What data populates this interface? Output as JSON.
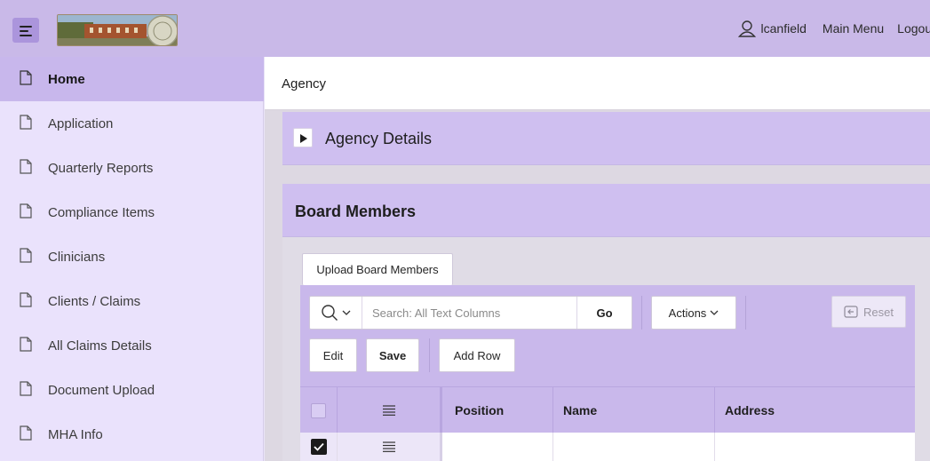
{
  "header": {
    "username": "lcanfield",
    "main_menu": "Main Menu",
    "logout": "Logout",
    "icons": {
      "menu": "hamburger-icon",
      "user": "user-icon"
    }
  },
  "sidebar": {
    "items": [
      {
        "label": "Home",
        "active": true
      },
      {
        "label": "Application"
      },
      {
        "label": "Quarterly Reports"
      },
      {
        "label": "Compliance Items"
      },
      {
        "label": "Clinicians"
      },
      {
        "label": "Clients / Claims"
      },
      {
        "label": "All Claims Details"
      },
      {
        "label": "Document Upload"
      },
      {
        "label": "MHA Info"
      }
    ],
    "item_icon": "document-icon"
  },
  "page": {
    "title": "Agency",
    "regions": {
      "agency_details": {
        "title": "Agency Details",
        "collapsed": true
      },
      "board_members": {
        "title": "Board Members"
      }
    }
  },
  "board_members": {
    "upload_button": "Upload Board Members",
    "search": {
      "placeholder": "Search: All Text Columns",
      "value": ""
    },
    "go": "Go",
    "actions": "Actions",
    "reset": "Reset",
    "edit": "Edit",
    "save": "Save",
    "add_row": "Add Row",
    "columns": [
      "Position",
      "Name",
      "Address"
    ],
    "rows": [
      {
        "selected": true,
        "position": "",
        "name": "",
        "address": ""
      }
    ]
  },
  "colors": {
    "header_bg": "#c9b9e8",
    "sidebar_bg": "#eae2fc",
    "sidebar_active": "#c8b7ec",
    "region_header": "#cfbff0",
    "toolbar_bg": "#c9b8eb"
  }
}
